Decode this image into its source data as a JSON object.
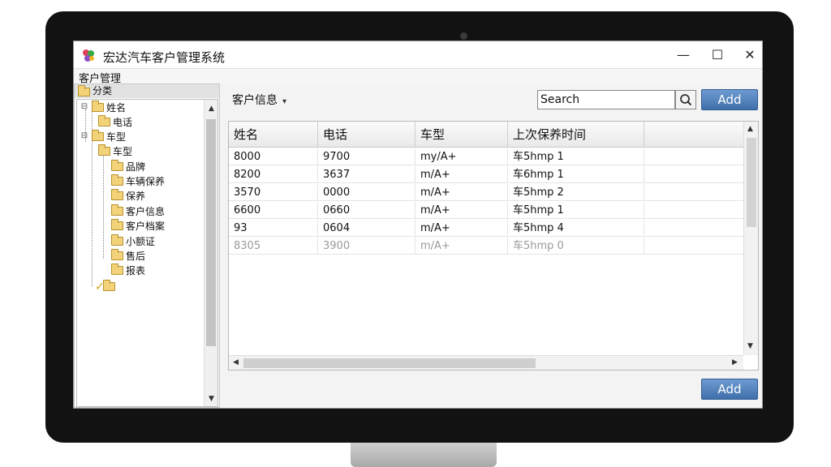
{
  "window": {
    "title": "宏达汽车客户管理系统",
    "minimize_glyph": "—",
    "maximize_glyph": "☐",
    "close_glyph": "✕"
  },
  "menubar": {
    "label": "客户管理"
  },
  "sidebar": {
    "root_label": "分类",
    "items": [
      {
        "label": "姓名"
      },
      {
        "label": "电话"
      },
      {
        "label": "车型"
      },
      {
        "label": "车型"
      },
      {
        "label": "品牌"
      },
      {
        "label": "车辆保养"
      },
      {
        "label": "保养"
      },
      {
        "label": "客户信息"
      },
      {
        "label": "客户档案"
      },
      {
        "label": "小额证"
      },
      {
        "label": "售后"
      },
      {
        "label": "报表"
      }
    ]
  },
  "main": {
    "section_label": "客户信息",
    "search": {
      "value": "Search",
      "placeholder": "Search"
    },
    "add_top_label": "Add",
    "add_bottom_label": "Add"
  },
  "grid": {
    "columns": [
      "姓名",
      "电话",
      "车型",
      "上次保养时间",
      ""
    ],
    "rows": [
      [
        "8000",
        "9700",
        "my/A+",
        "车5hmp 1"
      ],
      [
        "8200",
        "3637",
        "m/A+",
        "车6hmp 1"
      ],
      [
        "3570",
        "0000",
        "m/A+",
        "车5hmp 2"
      ],
      [
        "6600",
        "0660",
        "m/A+",
        "车5hmp 1"
      ],
      [
        "93",
        "0604",
        "m/A+",
        "车5hmp 4"
      ],
      [
        "8305",
        "3900",
        "m/A+",
        "车5hmp 0"
      ]
    ]
  },
  "icons": {
    "app": "app-logo-icon",
    "search": "search-icon",
    "folder": "folder-icon"
  },
  "colors": {
    "accent": "#4a7bb7"
  }
}
